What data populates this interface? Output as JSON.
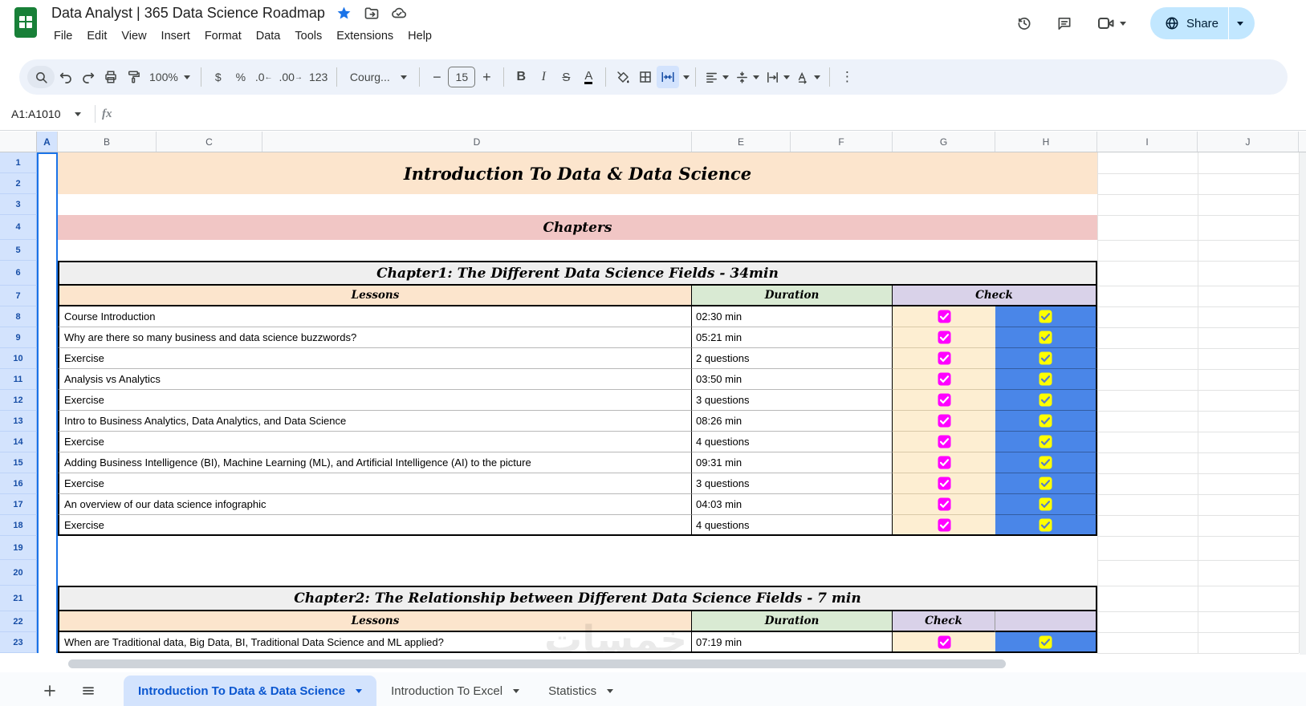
{
  "titlebar": {
    "doc_title": "Data Analyst | 365 Data Science Roadmap",
    "menu_items": [
      "File",
      "Edit",
      "View",
      "Insert",
      "Format",
      "Data",
      "Tools",
      "Extensions",
      "Help"
    ],
    "share_label": "Share"
  },
  "toolbar": {
    "zoom_value": "100%",
    "currency_label": "$",
    "percent_label": "%",
    "decrease_decimal_label": ".0",
    "increase_decimal_label": ".00",
    "number_format_label": "123",
    "font_name": "Courg...",
    "font_size": "15",
    "bold_label": "B",
    "italic_label": "I",
    "strikethrough_label": "S",
    "text_color_label": "A",
    "more_label": "⋮"
  },
  "formula_bar": {
    "name_box_value": "A1:A1010",
    "fx_label": "fx"
  },
  "grid": {
    "column_headers": [
      "A",
      "B",
      "C",
      "D",
      "E",
      "F",
      "G",
      "H",
      "I",
      "J"
    ],
    "row_numbers": [
      1,
      2,
      3,
      4,
      5,
      6,
      7,
      8,
      9,
      10,
      11,
      12,
      13,
      14,
      15,
      16,
      17,
      18,
      19,
      20,
      21,
      22,
      23
    ],
    "title_banner": "Introduction To Data & Data Science",
    "chapters_banner": "Chapters",
    "chapter1": {
      "title": "Chapter1: The Different Data Science Fields - 34min",
      "headers": {
        "lessons": "Lessons",
        "duration": "Duration",
        "check": "Check"
      },
      "rows": [
        {
          "lesson": "Course Introduction",
          "duration": "02:30 min",
          "check1": true,
          "check2": true
        },
        {
          "lesson": "Why are there so many business and data science buzzwords?",
          "duration": "05:21 min",
          "check1": true,
          "check2": true
        },
        {
          "lesson": "Exercise",
          "duration": "2 questions",
          "check1": true,
          "check2": true
        },
        {
          "lesson": "Analysis vs Analytics",
          "duration": "03:50 min",
          "check1": true,
          "check2": true
        },
        {
          "lesson": "Exercise",
          "duration": "3 questions",
          "check1": true,
          "check2": true
        },
        {
          "lesson": "Intro to Business Analytics, Data Analytics, and Data Science",
          "duration": "08:26 min",
          "check1": true,
          "check2": true
        },
        {
          "lesson": "Exercise",
          "duration": "4 questions",
          "check1": true,
          "check2": true
        },
        {
          "lesson": "Adding Business Intelligence (BI), Machine Learning (ML), and Artificial Intelligence (AI) to the picture",
          "duration": "09:31 min",
          "check1": true,
          "check2": true
        },
        {
          "lesson": "Exercise",
          "duration": "3 questions",
          "check1": true,
          "check2": true
        },
        {
          "lesson": "An overview of our data science infographic",
          "duration": "04:03 min",
          "check1": true,
          "check2": true
        },
        {
          "lesson": "Exercise",
          "duration": "4 questions",
          "check1": true,
          "check2": true
        }
      ]
    },
    "chapter2": {
      "title": "Chapter2: The Relationship between Different Data Science Fields - 7 min",
      "headers": {
        "lessons": "Lessons",
        "duration": "Duration",
        "check": "Check"
      },
      "rows": [
        {
          "lesson": "When are Traditional data, Big Data, BI, Traditional Data Science and ML applied?",
          "duration": "07:19 min",
          "check1": true,
          "check2": true
        }
      ]
    }
  },
  "sheet_tabs": {
    "active_tab": "Introduction To Data & Data Science",
    "other_tabs": [
      "Introduction To Excel",
      "Statistics"
    ]
  },
  "watermark_text": "خمسات",
  "colors": {
    "accent_blue": "#0b57d0",
    "selection_blue": "#1a73e8",
    "header_highlight": "#d3e3fd",
    "title_banner_bg": "#fce5cd",
    "chapters_banner_bg": "#f1c6c5",
    "chapter_band_bg": "#efefef",
    "lessons_header_bg": "#fce5cd",
    "duration_header_bg": "#d9ead3",
    "check_header_bg": "#d9d2e9",
    "check_col1_bg": "#fdeed2",
    "check_col2_bg": "#4a86e8",
    "checkbox1": "#ff00ff",
    "checkbox2": "#ffff00",
    "share_bg": "#c2e7ff",
    "logo_green": "#188038"
  }
}
